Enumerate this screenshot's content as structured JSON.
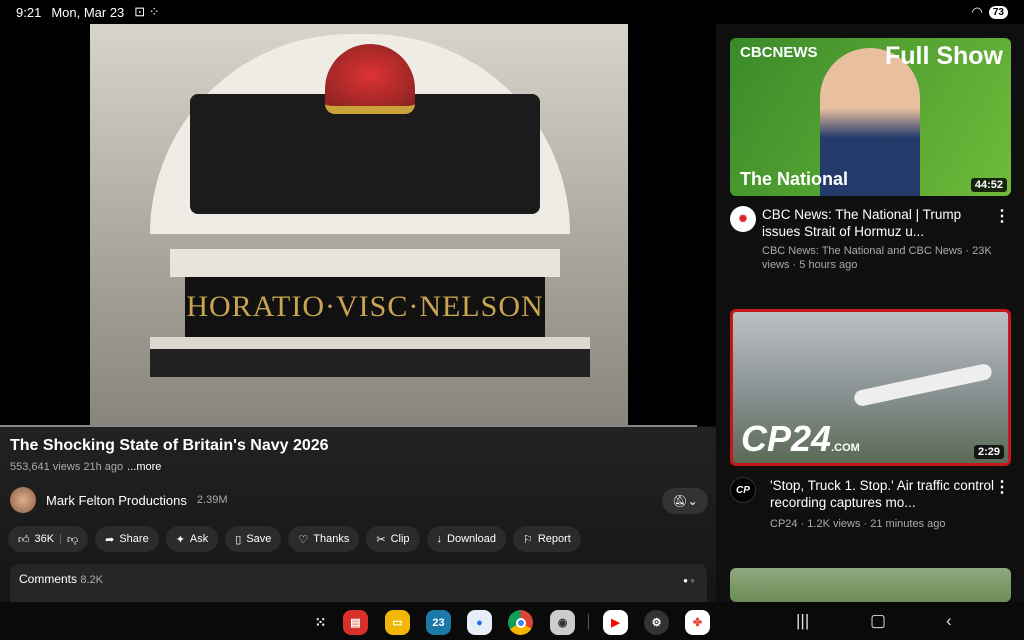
{
  "status": {
    "time": "9:21",
    "date": "Mon, Mar 23",
    "battery": "73"
  },
  "video": {
    "engraving": "HORATIO·VISC·NELSON",
    "title": "The Shocking State of Britain's Navy 2026",
    "meta": "553,641 views 21h ago",
    "more": "...more",
    "channel": "Mark Felton Productions",
    "subscribers": "2.39M",
    "progress_percent": 100
  },
  "actions": [
    {
      "icon": "thumbs-up-icon",
      "label": "36K"
    },
    {
      "icon": "share-icon",
      "label": "Share"
    },
    {
      "icon": "sparkle-icon",
      "label": "Ask"
    },
    {
      "icon": "bookmark-icon",
      "label": "Save"
    },
    {
      "icon": "thanks-icon",
      "label": "Thanks"
    },
    {
      "icon": "scissors-icon",
      "label": "Clip"
    },
    {
      "icon": "download-icon",
      "label": "Download"
    },
    {
      "icon": "flag-icon",
      "label": "Report"
    }
  ],
  "comments": {
    "label": "Comments",
    "count": "8.2K"
  },
  "related": [
    {
      "thumb_brand": "CBCNEWS",
      "thumb_headline": "Full Show",
      "thumb_caption": "The National",
      "duration": "44:52",
      "title": "CBC News: The National | Trump issues Strait of Hormuz u...",
      "meta": "CBC News: The National and CBC News · 23K views · 5 hours ago",
      "accent": "#e01f26"
    },
    {
      "thumb_brand": "CP24",
      "thumb_suffix": ".COM",
      "duration": "2:29",
      "title": "'Stop, Truck 1. Stop.' Air traffic control recording captures mo...",
      "meta": "CP24 · 1.2K views · 21 minutes ago",
      "accent": "#c4181b"
    }
  ],
  "dock": {
    "calendar_day": "23"
  }
}
